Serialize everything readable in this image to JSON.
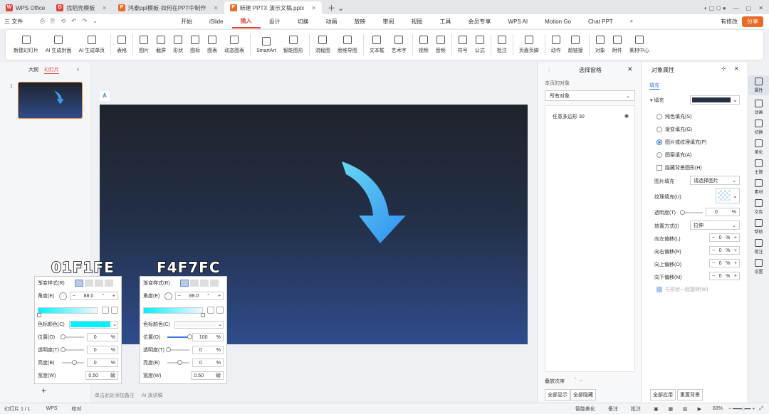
{
  "tabs": [
    {
      "label": "WPS Office",
      "icon": "wps-logo-icon",
      "color": "#e0433a"
    },
    {
      "label": "找稻壳模板",
      "icon": "docer-icon",
      "color": "#e0433a"
    },
    {
      "label": "鸿泰ppt模板-如何在PPT中制作科...",
      "icon": "ppt-file-icon",
      "color": "#e86b2a"
    },
    {
      "label": "新建 PPTX 演示文稿.pptx",
      "icon": "ppt-file-icon",
      "color": "#e86b2a"
    }
  ],
  "menu": {
    "file": "三 文件",
    "items": [
      "开始",
      "iSlide",
      "插入",
      "设计",
      "切换",
      "动画",
      "放映",
      "审阅",
      "视图",
      "工具",
      "会员专享",
      "WPS AI",
      "Motion Go",
      "Chat PPT"
    ],
    "active": "插入",
    "has_edit": "有修改",
    "share": "分享"
  },
  "ribbon": [
    "新建幻灯片",
    "AI 生成封面",
    "AI 生成单页",
    "表格",
    "图片",
    "截屏",
    "形状",
    "图标",
    "图表",
    "动态图表",
    "SmartArt",
    "智能图形",
    "流程图",
    "思维导图",
    "文本框",
    "艺术字",
    "视频",
    "音频",
    "符号",
    "公式",
    "批注",
    "页眉页脚",
    "动作",
    "超链接",
    "对象",
    "附件",
    "素材中心"
  ],
  "left": {
    "outline": "大纲",
    "slides": "幻灯片",
    "slide_number": "1"
  },
  "selection": {
    "title": "选择窗格",
    "subtitle": "本页的对象",
    "filter": "所有对象",
    "item": "任意多边形 30",
    "order": "叠放次序",
    "show_all": "全部显示",
    "hide_all": "全部隐藏"
  },
  "props": {
    "title": "对象属性",
    "tab": "填充",
    "section": "填充",
    "fill_color": "#263042",
    "options": [
      "纯色填充(S)",
      "渐变填充(G)",
      "图片或纹理填充(P)",
      "图案填充(A)"
    ],
    "selected_option": "图片或纹理填充(P)",
    "hide_bg": "隐藏背景图形(H)",
    "picture_fill_label": "图片填充",
    "picture_fill_value": "请选择图片",
    "texture_label": "纹理填充(U)",
    "transparency_label": "透明度(T)",
    "transparency_value": "0",
    "placement_label": "放置方式(I)",
    "placement_value": "拉伸",
    "offsets": [
      {
        "label": "向左偏移(L)",
        "value": "0",
        "unit": "%"
      },
      {
        "label": "向右偏移(R)",
        "value": "0",
        "unit": "%"
      },
      {
        "label": "向上偏移(O)",
        "value": "0",
        "unit": "%"
      },
      {
        "label": "向下偏移(M)",
        "value": "0",
        "unit": "%"
      }
    ],
    "rotate_with": "与形状一起旋转(W)",
    "apply_all": "全部应用",
    "reset_bg": "重置背景"
  },
  "right_sidebar": [
    "属性",
    "动画",
    "切换",
    "美化",
    "主题",
    "素材",
    "文库",
    "帮助",
    "批注",
    "设置"
  ],
  "gradient_panels": [
    {
      "hex": "01F1FE",
      "style": "渐变样式(R)",
      "angle_label": "角度(E)",
      "angle": "88.0",
      "angle_unit": "°",
      "color_label": "色标颜色(C)",
      "swatch": "#01f1fe",
      "position_label": "位置(O)",
      "position": "0",
      "trans_label": "透明度(T)",
      "trans": "0",
      "bright_label": "亮度(B)",
      "bright": "0",
      "width_label": "宽度(W)",
      "width": "0.50",
      "width_unit": "磅",
      "unit": "%"
    },
    {
      "hex": "F4F7FC",
      "style": "渐变样式(R)",
      "angle_label": "角度(E)",
      "angle": "88.0",
      "angle_unit": "°",
      "color_label": "色标颜色(C)",
      "swatch": "#f4f7fc",
      "position_label": "位置(O)",
      "position": "100",
      "trans_label": "透明度(T)",
      "trans": "0",
      "bright_label": "亮度(B)",
      "bright": "0",
      "width_label": "宽度(W)",
      "width": "0.50",
      "width_unit": "磅",
      "unit": "%"
    }
  ],
  "notes": {
    "placeholder": "单击此处添加备注",
    "ai": "AI 演讲稿"
  },
  "status": {
    "slide": "幻灯片 1 / 1",
    "wps": "WPS",
    "proof": "校对",
    "beautify": "智能美化",
    "notes": "备注",
    "comments": "批注",
    "zoom": "83%"
  }
}
